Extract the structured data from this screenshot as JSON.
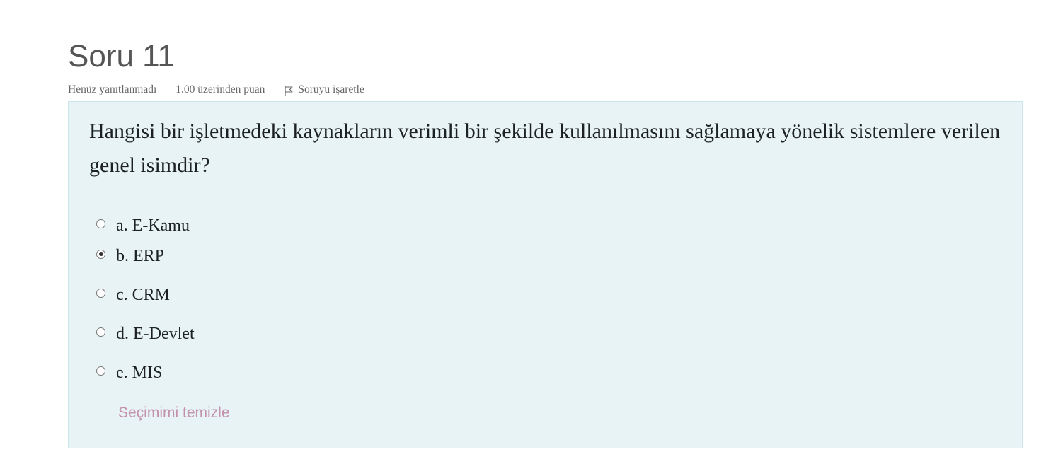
{
  "question": {
    "title": "Soru 11",
    "state": "Henüz yanıtlanmadı",
    "grade": "1.00 üzerinden puan",
    "flag_label": "Soruyu işaretle",
    "text": "Hangisi  bir işletmedeki kaynakların verimli bir şekilde kullanılmasını sağlamaya yönelik sistemlere verilen genel isimdir?",
    "answers": [
      {
        "label": "a. E-Kamu",
        "selected": false
      },
      {
        "label": "b. ERP",
        "selected": true
      },
      {
        "label": "c. CRM",
        "selected": false
      },
      {
        "label": "d. E-Devlet",
        "selected": false
      },
      {
        "label": "e. MIS",
        "selected": false
      }
    ],
    "clear_label": "Seçimimi temizle"
  },
  "colors": {
    "content_bg": "#e7f3f5",
    "content_border": "#c9e6eb",
    "clear_link": "#c391ab",
    "title": "#555555"
  },
  "icons": {
    "flag": "flag-icon"
  }
}
